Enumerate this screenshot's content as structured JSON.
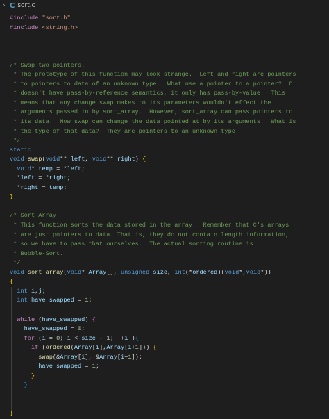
{
  "tab": {
    "title": "sort.c"
  },
  "code": [
    "#include \"sort.h\"",
    "#include <string.h>",
    "",
    "",
    "",
    "/* Swap two pointers.",
    " * The prototype of this function may look strange.  Left and right are pointers",
    " * to pointers to data of an unknown type.  What use a pointer to a pointer?  C",
    " * doesn't have pass-by-reference semantics, it only has pass-by-value.  This",
    " * means that any change swap makes to its parameters wouldn't effect the",
    " * arguments passed in by sort_array.  However, sort_array can pass pointers to",
    " * its data.  Now swap can change the data pointed at by its arguments.  What is",
    " * the type of that data?  They are pointers to an unknown type.",
    " */",
    "static",
    "void swap(void** left, void** right) {",
    "  void* temp = *left;",
    "  *left = *right;",
    "  *right = temp;",
    "}",
    "",
    "/* Sort Array",
    " * This function sorts the data stored in the array.  Remember that C's arrays",
    " * are just pointers to data. That is, they do not contain length information,",
    " * so we have to pass that ourselves.  The actual sorting routine is",
    " * Bubble-Sort.",
    " */",
    "void sort_array(void* Array[], unsigned size, int(*ordered)(void*,void*))",
    "{",
    "  int i,j;",
    "  int have_swapped = 1;",
    "",
    "  while (have_swapped) {",
    "    have_swapped = 0;",
    "    for (i = 0; i < size - 1; ++i ){",
    "      if (ordered(Array[i],Array[i+1])) {",
    "        swap(&Array[i], &Array[i+1]);",
    "        have_swapped = 1;",
    "      }",
    "    }",
    "",
    "",
    "}"
  ]
}
